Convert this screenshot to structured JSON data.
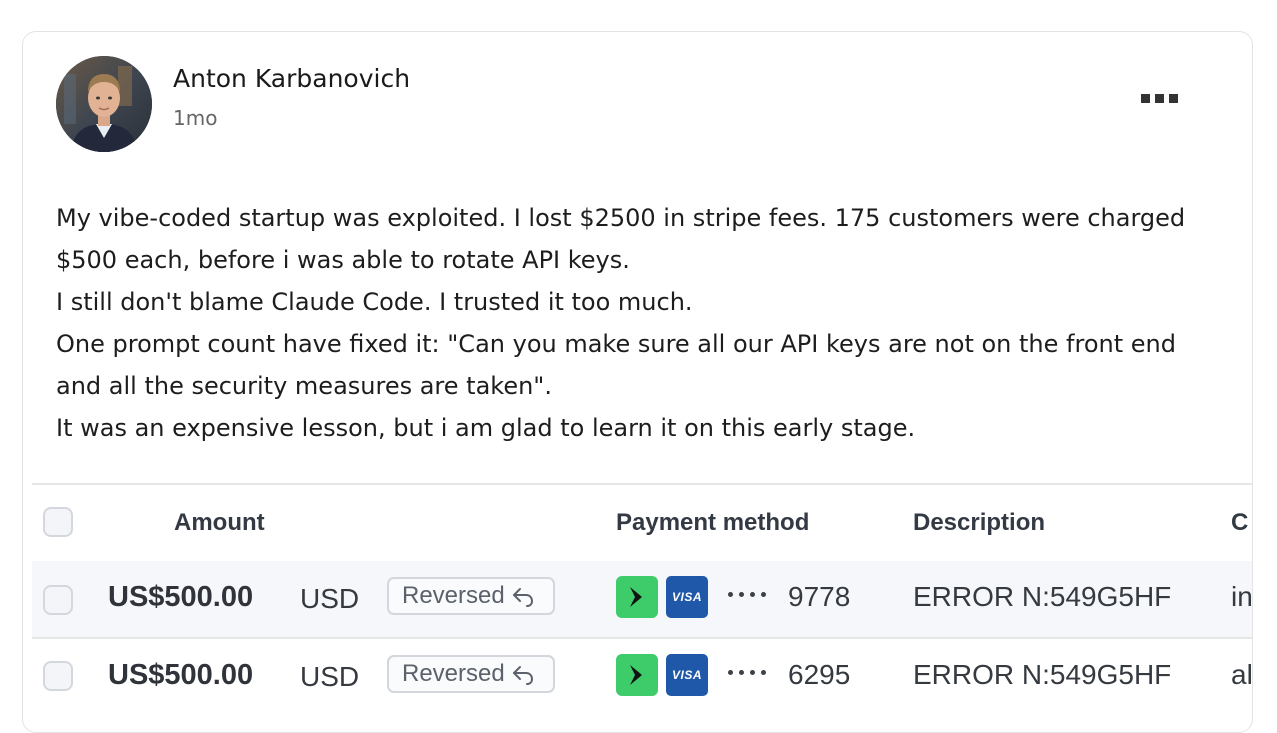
{
  "post": {
    "author": "Anton Karbanovich",
    "time": "1mo",
    "lines": [
      "My vibe-coded startup was exploited. I lost $2500 in stripe fees. 175 customers were charged",
      "$500 each, before i was able to rotate API keys.",
      "I still don't blame Claude Code. I trusted it too much.",
      "One prompt count have fixed it: \"Can you make sure all our API keys are not on the front end",
      "and all the security measures are taken\".",
      "It was an expensive lesson, but i am glad to learn it on this early stage."
    ]
  },
  "table": {
    "headers": {
      "amount": "Amount",
      "payment_method": "Payment method",
      "description": "Description",
      "customer": "C"
    },
    "rows": [
      {
        "amount": "US$500.00",
        "currency": "USD",
        "status": "Reversed",
        "card_brand": "VISA",
        "last4": "9778",
        "description": "ERROR N:549G5HF",
        "customer": "in"
      },
      {
        "amount": "US$500.00",
        "currency": "USD",
        "status": "Reversed",
        "card_brand": "VISA",
        "last4": "6295",
        "description": "ERROR N:549G5HF",
        "customer": "al"
      }
    ]
  },
  "icons": {
    "more": "more-horizontal-icon",
    "reversed": "undo-arrow-icon",
    "link_pay": "link-pay-icon",
    "card": "visa-card-icon"
  },
  "colors": {
    "link_green": "#3ecb6a",
    "visa_blue": "#1f57a9",
    "row_highlight": "#f5f7fa"
  }
}
